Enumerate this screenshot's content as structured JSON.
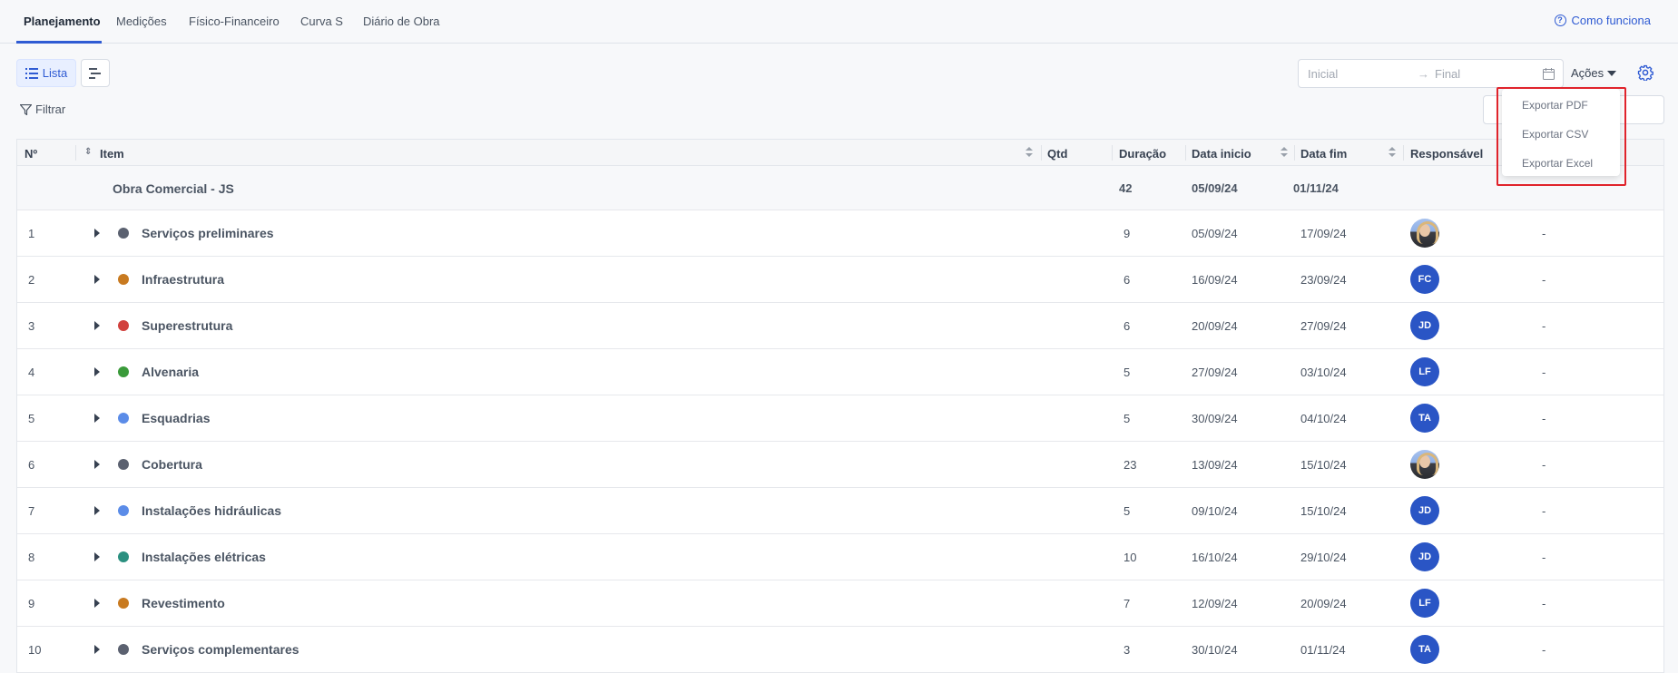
{
  "tabs": [
    {
      "label": "Planejamento"
    },
    {
      "label": "Medições"
    },
    {
      "label": "Físico-Financeiro"
    },
    {
      "label": "Curva S"
    },
    {
      "label": "Diário de Obra"
    }
  ],
  "help": {
    "label": "Como funciona",
    "icon": "question-circle-icon"
  },
  "toolbar": {
    "list_label": "Lista",
    "list_icon": "list-icon",
    "gantt_icon": "gantt-icon",
    "filter_label": "Filtrar",
    "date_start_placeholder": "Inicial",
    "date_end_placeholder": "Final",
    "actions_label": "Ações"
  },
  "actions_menu": {
    "items": [
      {
        "label": "Exportar PDF"
      },
      {
        "label": "Exportar CSV"
      },
      {
        "label": "Exportar Excel"
      }
    ]
  },
  "table": {
    "headers": {
      "num": "Nº",
      "item": "Item",
      "qtd": "Qtd",
      "duracao": "Duração",
      "inicio": "Data inicio",
      "fim": "Data fim",
      "responsavel": "Responsável"
    },
    "group": {
      "name": "Obra Comercial - JS",
      "duracao": "42",
      "inicio": "05/09/24",
      "fim": "01/11/24"
    },
    "rows": [
      {
        "num": "1",
        "name": "Serviços preliminares",
        "color": "#5b6170",
        "duracao": "9",
        "inicio": "05/09/24",
        "fim": "17/09/24",
        "resp": "",
        "resp_type": "photo",
        "extra": "-"
      },
      {
        "num": "2",
        "name": "Infraestrutura",
        "color": "#c87a20",
        "duracao": "6",
        "inicio": "16/09/24",
        "fim": "23/09/24",
        "resp": "FC",
        "resp_type": "initials",
        "extra": "-"
      },
      {
        "num": "3",
        "name": "Superestrutura",
        "color": "#d1413d",
        "duracao": "6",
        "inicio": "20/09/24",
        "fim": "27/09/24",
        "resp": "JD",
        "resp_type": "initials",
        "extra": "-"
      },
      {
        "num": "4",
        "name": "Alvenaria",
        "color": "#3a9a3a",
        "duracao": "5",
        "inicio": "27/09/24",
        "fim": "03/10/24",
        "resp": "LF",
        "resp_type": "initials",
        "extra": "-"
      },
      {
        "num": "5",
        "name": "Esquadrias",
        "color": "#5b8ce8",
        "duracao": "5",
        "inicio": "30/09/24",
        "fim": "04/10/24",
        "resp": "TA",
        "resp_type": "initials",
        "extra": "-"
      },
      {
        "num": "6",
        "name": "Cobertura",
        "color": "#5b6170",
        "duracao": "23",
        "inicio": "13/09/24",
        "fim": "15/10/24",
        "resp": "",
        "resp_type": "photo",
        "extra": "-"
      },
      {
        "num": "7",
        "name": "Instalações hidráulicas",
        "color": "#5b8ce8",
        "duracao": "5",
        "inicio": "09/10/24",
        "fim": "15/10/24",
        "resp": "JD",
        "resp_type": "initials",
        "extra": "-"
      },
      {
        "num": "8",
        "name": "Instalações elétricas",
        "color": "#2b9080",
        "duracao": "10",
        "inicio": "16/10/24",
        "fim": "29/10/24",
        "resp": "JD",
        "resp_type": "initials",
        "extra": "-"
      },
      {
        "num": "9",
        "name": "Revestimento",
        "color": "#c87a20",
        "duracao": "7",
        "inicio": "12/09/24",
        "fim": "20/09/24",
        "resp": "LF",
        "resp_type": "initials",
        "extra": "-"
      },
      {
        "num": "10",
        "name": "Serviços complementares",
        "color": "#5b6170",
        "duracao": "3",
        "inicio": "30/10/24",
        "fim": "01/11/24",
        "resp": "TA",
        "resp_type": "initials",
        "extra": "-"
      }
    ]
  },
  "colors": {
    "accent": "#2f5bd3",
    "highlight": "#e0232b",
    "avatar": "#2a55c5"
  }
}
